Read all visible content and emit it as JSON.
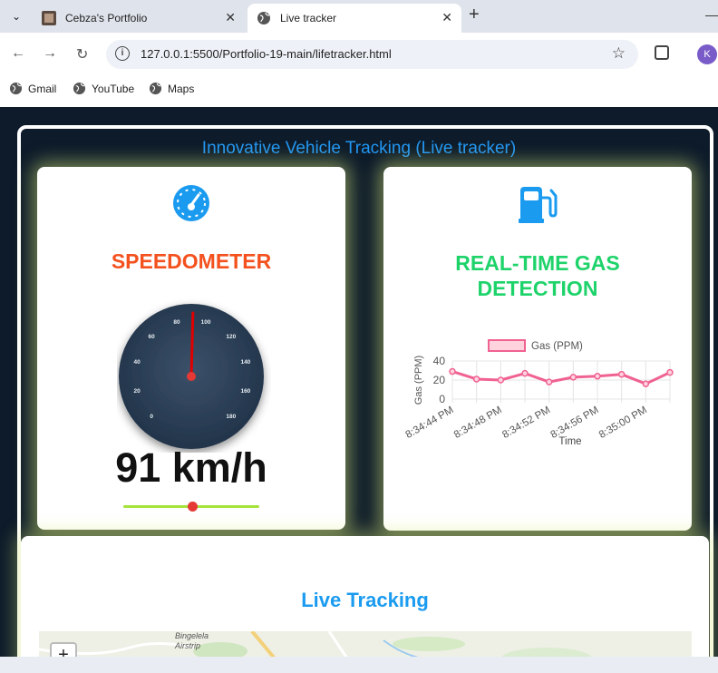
{
  "browser": {
    "tabs": [
      {
        "title": "Cebza's Portfolio",
        "active": false
      },
      {
        "title": "Live tracker",
        "active": true
      }
    ],
    "url": "127.0.0.1:5500/Portfolio-19-main/lifetracker.html",
    "profile_initial": "K",
    "bookmarks": [
      "Gmail",
      "YouTube",
      "Maps"
    ]
  },
  "page": {
    "title": "Innovative Vehicle Tracking (Live tracker)"
  },
  "speedometer": {
    "title": "SPEEDOMETER",
    "value_text": "91 km/h",
    "speed": 91,
    "dial_labels": [
      "0",
      "20",
      "40",
      "60",
      "80",
      "100",
      "120",
      "140",
      "160",
      "180"
    ],
    "accent_color": "#f4511e"
  },
  "gas": {
    "title_line1": "REAL-TIME GAS",
    "title_line2": "DETECTION",
    "accent_color": "#1fd36b"
  },
  "chart_data": {
    "type": "line",
    "x": [
      "8:34:44 PM",
      "8:34:46 PM",
      "8:34:48 PM",
      "8:34:50 PM",
      "8:34:52 PM",
      "8:34:54 PM",
      "8:34:56 PM",
      "8:34:58 PM",
      "8:35:00 PM",
      "8:35:02 PM"
    ],
    "tick_labels": [
      "8:34:44 PM",
      "8:34:48 PM",
      "8:34:52 PM",
      "8:34:56 PM",
      "8:35:00 PM"
    ],
    "series": [
      {
        "name": "Gas (PPM)",
        "values": [
          29,
          21,
          20,
          27,
          18,
          23,
          24,
          26,
          16,
          28
        ],
        "color": "#f06292"
      }
    ],
    "xlabel": "Time",
    "ylabel": "Gas (PPM)",
    "y_ticks": [
      "0",
      "20",
      "40"
    ],
    "ylim": [
      0,
      40
    ],
    "grid": true,
    "legend": "top"
  },
  "map": {
    "title": "Live Tracking",
    "zoom_in_label": "+",
    "place_label_line1": "Bingelela",
    "place_label_line2": "Airstrip"
  }
}
